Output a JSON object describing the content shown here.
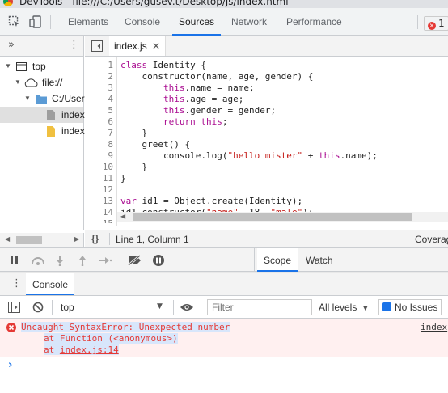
{
  "window": {
    "title": "DevTools - file:///C:/Users/gusev.t/Desktop/js/index.html"
  },
  "tabs": [
    {
      "label": "Elements"
    },
    {
      "label": "Console"
    },
    {
      "label": "Sources"
    },
    {
      "label": "Network"
    },
    {
      "label": "Performance"
    }
  ],
  "error_count": "1",
  "navigator": {
    "tree": [
      {
        "label": "top"
      },
      {
        "label": "file://"
      },
      {
        "label": "C:/User"
      },
      {
        "label": "index"
      },
      {
        "label": "index"
      }
    ]
  },
  "editor": {
    "file_tab": "index.js",
    "line_numbers": [
      "1",
      "2",
      "3",
      "4",
      "5",
      "6",
      "7",
      "8",
      "9",
      "10",
      "11",
      "12",
      "13",
      "14",
      "15"
    ],
    "status": "Line 1, Column 1",
    "coverage": "Coverag",
    "braces": "{}"
  },
  "debugger": {
    "tabs": [
      {
        "label": "Scope"
      },
      {
        "label": "Watch"
      }
    ]
  },
  "drawer": {
    "tab": "Console"
  },
  "console": {
    "context": "top",
    "filter_placeholder": "Filter",
    "levels": "All levels",
    "issues": "No Issues",
    "error_line1": "Uncaught SyntaxError: Unexpected number",
    "error_line2": "at Function (<anonymous>)",
    "error_line3_prefix": "at ",
    "error_line3_link": "index.js:14",
    "error_source": "index"
  },
  "colors": {
    "accent": "#1a73e8",
    "error": "#e53935",
    "keyword": "#aa0d91",
    "string": "#c41a16"
  }
}
